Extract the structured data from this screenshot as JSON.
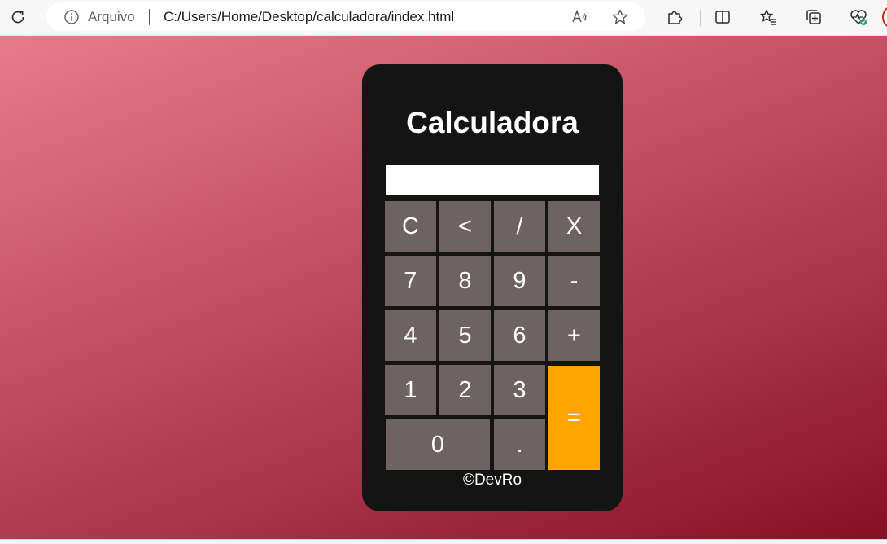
{
  "browser": {
    "site_info_label": "Arquivo",
    "url": "C:/Users/Home/Desktop/calculadora/index.html",
    "icons": {
      "reload": "reload-icon",
      "site_info": "info-icon",
      "read_aloud": "read-aloud-icon",
      "favorite": "star-icon",
      "extensions": "puzzle-icon",
      "split_screen": "split-screen-icon",
      "favorites": "favorites-icon",
      "collections": "collections-icon",
      "browser_essentials": "heart-pulse-icon"
    }
  },
  "page": {
    "background_colors": [
      "#e87b8b",
      "#c85668",
      "#a53247",
      "#870f24"
    ]
  },
  "calculator": {
    "title": "Calculadora",
    "display_value": "",
    "keys": {
      "clear": "C",
      "backspace": "<",
      "divide": "/",
      "multiply": "X",
      "seven": "7",
      "eight": "8",
      "nine": "9",
      "minus": "-",
      "four": "4",
      "five": "5",
      "six": "6",
      "plus": "+",
      "one": "1",
      "two": "2",
      "three": "3",
      "equals": "=",
      "zero": "0",
      "decimal": "."
    },
    "footer": "©DevRo",
    "colors": {
      "body": "#141414",
      "key": "#6e6262",
      "equals_key": "#ffa500",
      "text": "#ffffff"
    }
  }
}
